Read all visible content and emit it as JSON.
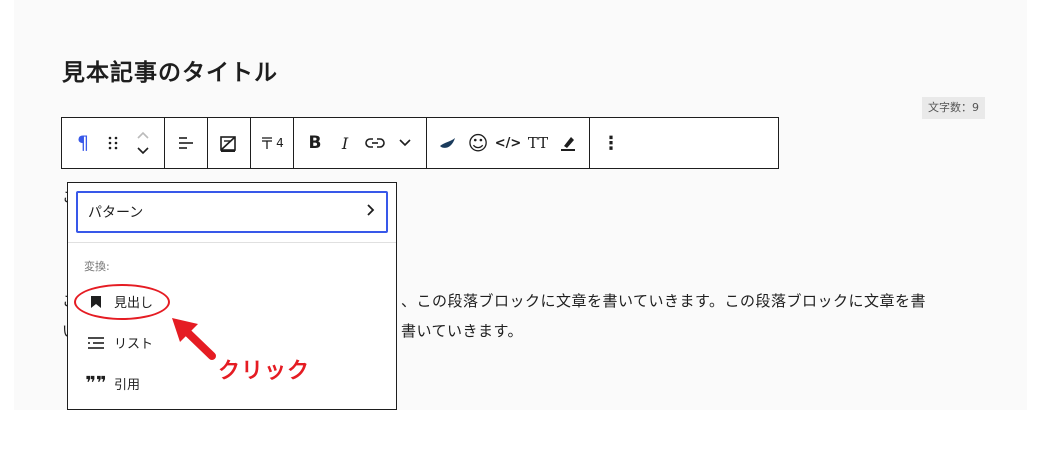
{
  "editor": {
    "title": "見本記事のタイトル",
    "char_count": "文字数：9",
    "paragraph_lines": [
      "、この段落ブロックに文章を書いていきます。この段落ブロックに文章を書",
      "書いていきます。"
    ],
    "left_fragments": [
      "こ",
      "こ",
      "い"
    ]
  },
  "toolbar": {
    "paragraph_icon": "¶",
    "drag_icon": "⠿",
    "move_icon": "⌃⌄",
    "align_icon": "align-left-icon",
    "font_size_badge": "4",
    "bold_label": "B",
    "italic_label": "I",
    "link_icon": "link-icon",
    "more_icon": "chevron-down-icon",
    "emoji_icon": "☺",
    "code_label": "</>",
    "text_transform_label": "TT",
    "options_icon": "⋮"
  },
  "dropdown": {
    "pattern_label": "パターン",
    "transform_section": "変換:",
    "items": [
      {
        "label": "見出し",
        "icon": "bookmark-icon"
      },
      {
        "label": "リスト",
        "icon": "list-icon"
      },
      {
        "label": "引用",
        "icon": "quote-icon"
      }
    ]
  },
  "annotation": {
    "click_text": "クリック",
    "color": "#e51c23"
  },
  "colors": {
    "accent": "#3858e9",
    "annotation_red": "#e51c23"
  }
}
